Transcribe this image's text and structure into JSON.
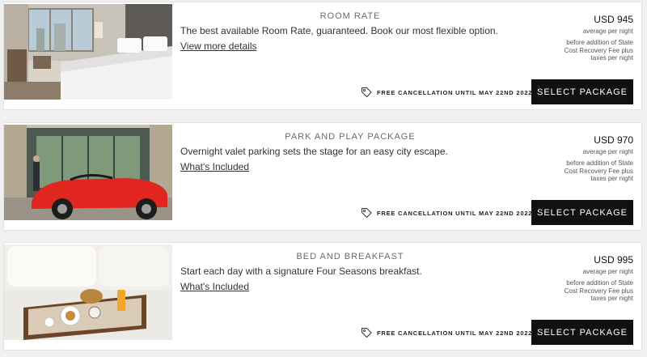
{
  "packages": [
    {
      "title": "ROOM RATE",
      "description": "The best available Room Rate, guaranteed. Book our most flexible option.",
      "link": "View more details",
      "cancellation": "FREE CANCELLATION UNTIL MAY 22ND 2022",
      "price": "USD 945",
      "per_night": "average per night",
      "tax_note": "before addition of State Cost Recovery Fee plus taxes per night",
      "button": "SELECT PACKAGE",
      "image": "hotel room with bed and city view"
    },
    {
      "title": "PARK AND PLAY PACKAGE",
      "description": "Overnight valet parking sets the stage for an easy city escape.",
      "link": "What's Included",
      "cancellation": "FREE CANCELLATION UNTIL MAY 22ND 2022",
      "price": "USD 970",
      "per_night": "average per night",
      "tax_note": "before addition of State Cost Recovery Fee plus taxes per night",
      "button": "SELECT PACKAGE",
      "image": "red convertible sports car at hotel entrance"
    },
    {
      "title": "BED AND BREAKFAST",
      "description": "Start each day with a signature Four Seasons breakfast.",
      "link": "What's Included",
      "cancellation": "FREE CANCELLATION UNTIL MAY 22ND 2022",
      "price": "USD 995",
      "per_night": "average per night",
      "tax_note": "before addition of State Cost Recovery Fee plus taxes per night",
      "button": "SELECT PACKAGE",
      "image": "breakfast tray on bed"
    }
  ],
  "colors": {
    "button_bg": "#111111",
    "button_text": "#ffffff",
    "page_bg": "#f0f0f0",
    "card_bg": "#ffffff"
  }
}
